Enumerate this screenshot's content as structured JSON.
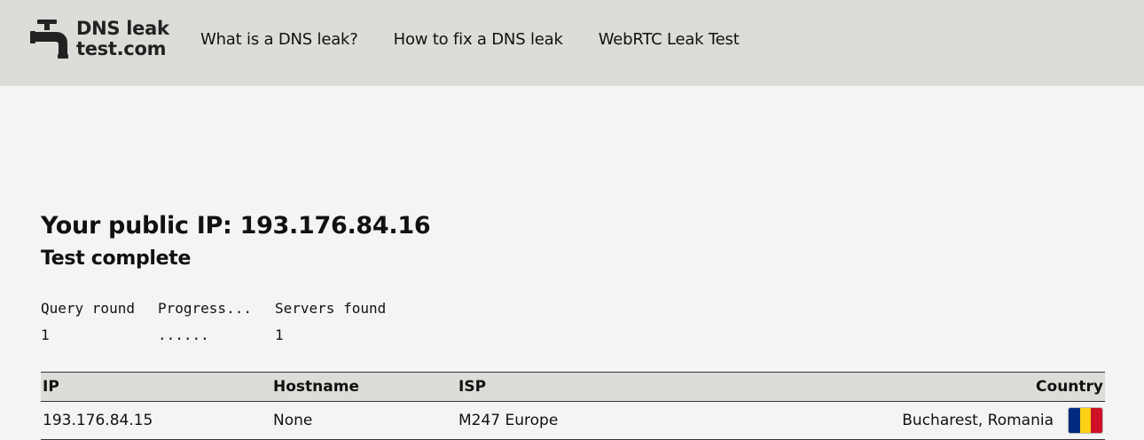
{
  "logo": {
    "line1": "DNS leak",
    "line2": "test.com"
  },
  "nav": [
    {
      "label": "What is a DNS leak?"
    },
    {
      "label": "How to fix a DNS leak"
    },
    {
      "label": "WebRTC Leak Test"
    }
  ],
  "main": {
    "ip_heading": "Your public IP: 193.176.84.16",
    "status": "Test complete"
  },
  "progress": {
    "headers": [
      "Query round",
      "Progress...",
      "Servers found"
    ],
    "row": [
      "1",
      "......",
      "1"
    ]
  },
  "results": {
    "headers": {
      "ip": "IP",
      "hostname": "Hostname",
      "isp": "ISP",
      "country": "Country"
    },
    "rows": [
      {
        "ip": "193.176.84.15",
        "hostname": "None",
        "isp": "M247 Europe",
        "country": "Bucharest, Romania",
        "flag_icon": "romania-flag-icon"
      }
    ]
  },
  "colors": {
    "header_bg": "#dddcd8",
    "page_bg": "#f4f4f4",
    "flag_blue": "#002b7f",
    "flag_yellow": "#fcd116",
    "flag_red": "#ce1126"
  }
}
